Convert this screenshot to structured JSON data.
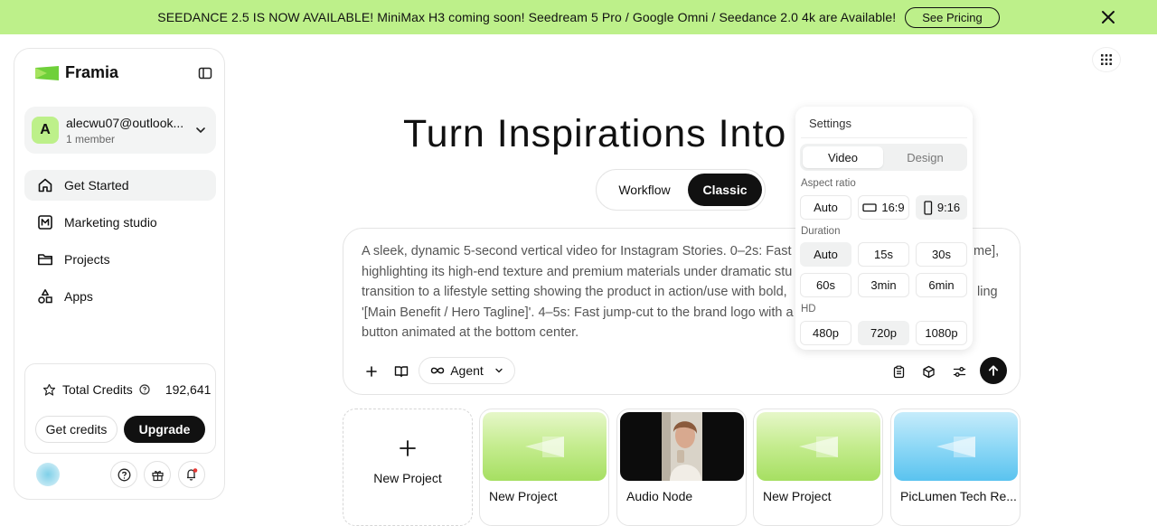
{
  "banner": {
    "text": "SEEDANCE 2.5 IS NOW AVAILABLE! MiniMax H3 coming soon! Seedream 5 Pro / Google Omni / Seedance 2.0 4k are Available!",
    "cta": "See Pricing",
    "bg_color": "#bdf08a"
  },
  "sidebar": {
    "logo": "Framia",
    "account": {
      "initial": "A",
      "email": "alecwu07@outlook...",
      "members": "1 member"
    },
    "nav": [
      {
        "label": "Get Started",
        "icon": "home-icon",
        "active": true
      },
      {
        "label": "Marketing studio",
        "icon": "marketing-m-icon",
        "active": false
      },
      {
        "label": "Projects",
        "icon": "folder-icon",
        "active": false
      },
      {
        "label": "Apps",
        "icon": "apps-shapes-icon",
        "active": false
      }
    ],
    "credits": {
      "label": "Total Credits",
      "value": "192,641",
      "get": "Get credits",
      "upgrade": "Upgrade"
    }
  },
  "hero": {
    "title": "Turn Inspirations Into Mas"
  },
  "modes": {
    "workflow": "Workflow",
    "classic": "Classic",
    "selected": "Classic"
  },
  "prompt": {
    "lines": [
      "A sleek, dynamic 5-second vertical video for Instagram Stories. 0–2s: Fast",
      "highlighting its high-end texture and premium materials under dramatic stu",
      "transition to a lifestyle setting showing the product in action/use with bold,",
      "'[Main Benefit / Hero Tagline]'. 4–5s: Fast jump-cut to the brand logo with a",
      "button animated at the bottom center."
    ],
    "right_fragments": [
      "me],",
      "ling"
    ],
    "agent_label": "Agent"
  },
  "settings": {
    "title": "Settings",
    "tabs": [
      "Video",
      "Design"
    ],
    "selected_tab": "Video",
    "aspect_label": "Aspect ratio",
    "aspect_options": [
      "Auto",
      "16:9",
      "9:16"
    ],
    "aspect_selected": "9:16",
    "duration_label": "Duration",
    "duration_options": [
      "Auto",
      "15s",
      "30s",
      "60s",
      "3min",
      "6min"
    ],
    "duration_selected": "Auto",
    "hd_label": "HD",
    "hd_options": [
      "480p",
      "720p",
      "1080p"
    ],
    "hd_selected": "720p"
  },
  "projects": {
    "new_label": "New Project",
    "cards": [
      {
        "label": "New Project",
        "thumb": "green"
      },
      {
        "label": "Audio Node",
        "thumb": "photo"
      },
      {
        "label": "New Project",
        "thumb": "green"
      },
      {
        "label": "PicLumen Tech Re...",
        "thumb": "blue"
      }
    ]
  }
}
